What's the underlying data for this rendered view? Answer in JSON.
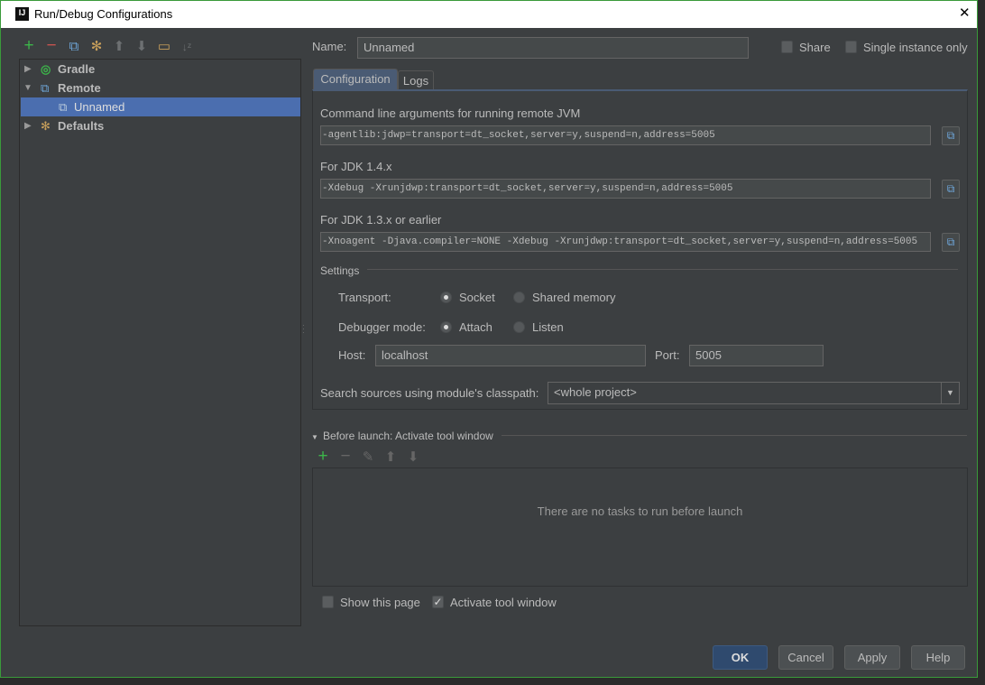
{
  "window": {
    "title": "Run/Debug Configurations",
    "app_icon": "IJ",
    "close": "✕"
  },
  "tree": {
    "toolbar": [
      "add-icon",
      "remove-icon",
      "copy-icon",
      "edit-defaults-icon",
      "move-up-icon",
      "move-down-icon",
      "folder-icon",
      "sort-icon"
    ],
    "items": [
      {
        "label": "Gradle",
        "expanded": false
      },
      {
        "label": "Remote",
        "expanded": true
      },
      {
        "label": "Unnamed",
        "selected": true
      },
      {
        "label": "Defaults",
        "expanded": false
      }
    ]
  },
  "name": {
    "label": "Name:",
    "value": "Unnamed"
  },
  "share": {
    "label": "Share",
    "checked": false
  },
  "single_instance": {
    "label": "Single instance only",
    "checked": false
  },
  "tabs": [
    {
      "label": "Configuration",
      "active": true
    },
    {
      "label": "Logs",
      "active": false
    }
  ],
  "config": {
    "cmd_label": "Command line arguments for running remote JVM",
    "cmd_value": "-agentlib:jdwp=transport=dt_socket,server=y,suspend=n,address=5005",
    "jdk14_label": "For JDK 1.4.x",
    "jdk14_value": "-Xdebug -Xrunjdwp:transport=dt_socket,server=y,suspend=n,address=5005",
    "jdk13_label": "For JDK 1.3.x or earlier",
    "jdk13_value": "-Xnoagent -Djava.compiler=NONE -Xdebug -Xrunjdwp:transport=dt_socket,server=y,suspend=n,address=5005",
    "settings_label": "Settings",
    "transport_label": "Transport:",
    "transport_options": [
      "Socket",
      "Shared memory"
    ],
    "transport_selected": "Socket",
    "mode_label": "Debugger mode:",
    "mode_options": [
      "Attach",
      "Listen"
    ],
    "mode_selected": "Attach",
    "host_label": "Host:",
    "host_value": "localhost",
    "port_label": "Port:",
    "port_value": "5005",
    "classpath_label": "Search sources using module's classpath:",
    "classpath_value": "<whole project>"
  },
  "before_launch": {
    "title": "Before launch: Activate tool window",
    "toolbar": [
      "add-icon",
      "remove-icon",
      "edit-icon",
      "move-up-icon",
      "move-down-icon"
    ],
    "empty_text": "There are no tasks to run before launch",
    "show_page": {
      "label": "Show this page",
      "checked": false
    },
    "activate": {
      "label": "Activate tool window",
      "checked": true
    }
  },
  "buttons": {
    "ok": "OK",
    "cancel": "Cancel",
    "apply": "Apply",
    "help": "Help"
  }
}
